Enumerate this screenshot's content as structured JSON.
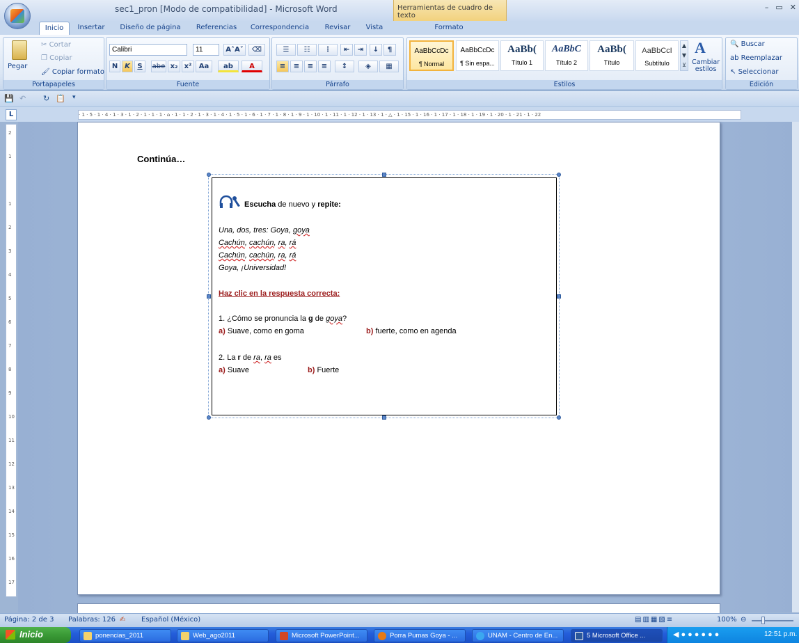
{
  "window": {
    "title": "sec1_pron [Modo de compatibilidad] - Microsoft Word",
    "context_tab_title": "Herramientas de cuadro de texto",
    "controls": [
      "–",
      "▭",
      "✕"
    ]
  },
  "tabs": [
    "Inicio",
    "Insertar",
    "Diseño de página",
    "Referencias",
    "Correspondencia",
    "Revisar",
    "Vista",
    "Formato"
  ],
  "ribbon": {
    "clipboard": {
      "paste": "Pegar",
      "cut": "Cortar",
      "copy": "Copiar",
      "format_painter": "Copiar formato",
      "label": "Portapapeles"
    },
    "font": {
      "family": "Calibri",
      "size": "11",
      "label": "Fuente",
      "bold": "N",
      "italic": "K",
      "underline": "S",
      "strike": "abe",
      "sub": "x₂",
      "sup": "x²",
      "case": "Aa"
    },
    "paragraph": {
      "label": "Párrafo"
    },
    "styles": {
      "label": "Estilos",
      "items": [
        {
          "sample": "AaBbCcDc",
          "name": "¶ Normal"
        },
        {
          "sample": "AaBbCcDc",
          "name": "¶ Sin espa..."
        },
        {
          "sample": "AaBb(",
          "name": "Título 1"
        },
        {
          "sample": "AaBbC",
          "name": "Título 2"
        },
        {
          "sample": "AaBb(",
          "name": "Título"
        },
        {
          "sample": "AaBbCcI",
          "name": "Subtítulo"
        }
      ],
      "change": "Cambiar estilos"
    },
    "editing": {
      "label": "Edición",
      "find": "Buscar",
      "replace": "Reemplazar",
      "select": "Seleccionar"
    }
  },
  "ruler": {
    "h_text": "· 1 · 5 · 1 · 4 · 1 · 3 · 1 · 2 · 1 · 1 · 1 · ⌂ · 1 · 1 · 2 · 1 · 3 · 1 · 4 · 1 · 5 · 1 · 6 · 1 · 7 · 1 · 8 · 1 · 9 · 1 · 10 · 1 · 11 · 1 · 12 · 1 · 13 · 1 · △ · 1 · 15 · 1 · 16 · 1 · 17 · 1 · 18 · 1 · 19 · 1 · 20 · 1 · 21 · 1 · 22",
    "corner": "L",
    "v_marks": [
      "2",
      "1",
      "",
      "1",
      "2",
      "3",
      "4",
      "5",
      "6",
      "7",
      "8",
      "9",
      "10",
      "11",
      "12",
      "13",
      "14",
      "15",
      "16",
      "17"
    ]
  },
  "document": {
    "continua": "Continúa…",
    "heading_bold1": "Escucha",
    "heading_mid": " de nuevo y ",
    "heading_bold2": "repite:",
    "verse": {
      "l1_a": "Una, dos, tres: Goya, ",
      "l1_b": "goya",
      "l2_a": "Cachún",
      "l2_b": ", ",
      "l2_c": "cachún",
      "l2_d": ", ",
      "l2_e": "ra",
      "l2_f": ", ",
      "l2_g": "rá",
      "l3_a": "Cachún",
      "l3_b": ", ",
      "l3_c": "cachún",
      "l3_d": ", ",
      "l3_e": "ra",
      "l3_f": ", ",
      "l3_g": "rá",
      "l4": "Goya, ¡Universidad!"
    },
    "instruction": "Haz clic en la respuesta correcta:",
    "q1": {
      "a": "1. ¿Cómo se pronuncia la ",
      "b": "g",
      "c": " de ",
      "d": "goya",
      "e": "?"
    },
    "q1_opt_a_label": "a)",
    "q1_opt_a": " Suave, como en goma",
    "q1_opt_b_label": "b)",
    "q1_opt_b": " fuerte, como en agenda",
    "q2": {
      "a": "2. La ",
      "b": "r",
      "c": " de ",
      "d": "ra",
      "e": ", ",
      "f": "ra",
      "g": " es"
    },
    "q2_opt_a_label": "a)",
    "q2_opt_a": " Suave",
    "q2_opt_b_label": "b)",
    "q2_opt_b": " Fuerte"
  },
  "status": {
    "page": "Página: 2 de 3",
    "words": "Palabras: 126",
    "language": "Español (México)",
    "zoom": "100%"
  },
  "taskbar": {
    "start": "Inicio",
    "items": [
      {
        "label": "ponencias_2011",
        "icon": "folder-icon"
      },
      {
        "label": "Web_ago2011",
        "icon": "folder-icon"
      },
      {
        "label": "Microsoft PowerPoint...",
        "icon": "powerpoint-icon"
      },
      {
        "label": "Porra Pumas Goya - ...",
        "icon": "firefox-icon"
      },
      {
        "label": "UNAM - Centro de En...",
        "icon": "ie-icon"
      },
      {
        "label": "5 Microsoft Office ...",
        "icon": "word-icon"
      }
    ],
    "clock": "12:51 p.m."
  }
}
